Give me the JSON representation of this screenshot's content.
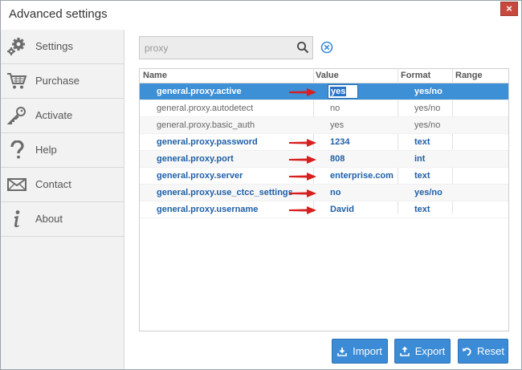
{
  "window": {
    "title": "Advanced settings",
    "close_label": "×"
  },
  "sidebar": {
    "items": [
      {
        "label": "Settings",
        "icon": "gear-icon"
      },
      {
        "label": "Purchase",
        "icon": "cart-icon"
      },
      {
        "label": "Activate",
        "icon": "key-icon"
      },
      {
        "label": "Help",
        "icon": "question-icon"
      },
      {
        "label": "Contact",
        "icon": "envelope-icon"
      },
      {
        "label": "About",
        "icon": "info-icon"
      }
    ]
  },
  "search": {
    "value": "proxy",
    "placeholder": ""
  },
  "grid": {
    "columns": [
      "Name",
      "Value",
      "Format",
      "Range"
    ],
    "rows": [
      {
        "name": "general.proxy.active",
        "value": "yes",
        "format": "yes/no",
        "range": ""
      },
      {
        "name": "general.proxy.autodetect",
        "value": "no",
        "format": "yes/no",
        "range": ""
      },
      {
        "name": "general.proxy.basic_auth",
        "value": "yes",
        "format": "yes/no",
        "range": ""
      },
      {
        "name": "general.proxy.password",
        "value": "1234",
        "format": "text",
        "range": ""
      },
      {
        "name": "general.proxy.port",
        "value": "808",
        "format": "int",
        "range": ""
      },
      {
        "name": "general.proxy.server",
        "value": "enterprise.com",
        "format": "text",
        "range": ""
      },
      {
        "name": "general.proxy.use_ctcc_settings",
        "value": "no",
        "format": "yes/no",
        "range": ""
      },
      {
        "name": "general.proxy.username",
        "value": "David",
        "format": "text",
        "range": ""
      }
    ]
  },
  "buttons": {
    "import": "Import",
    "export": "Export",
    "reset": "Reset"
  },
  "colors": {
    "accent": "#3b8bd6",
    "selected_row": "#3d8fd6",
    "modified_text": "#1f5fa6",
    "arrow": "#d81f1f",
    "close": "#c9483e"
  }
}
